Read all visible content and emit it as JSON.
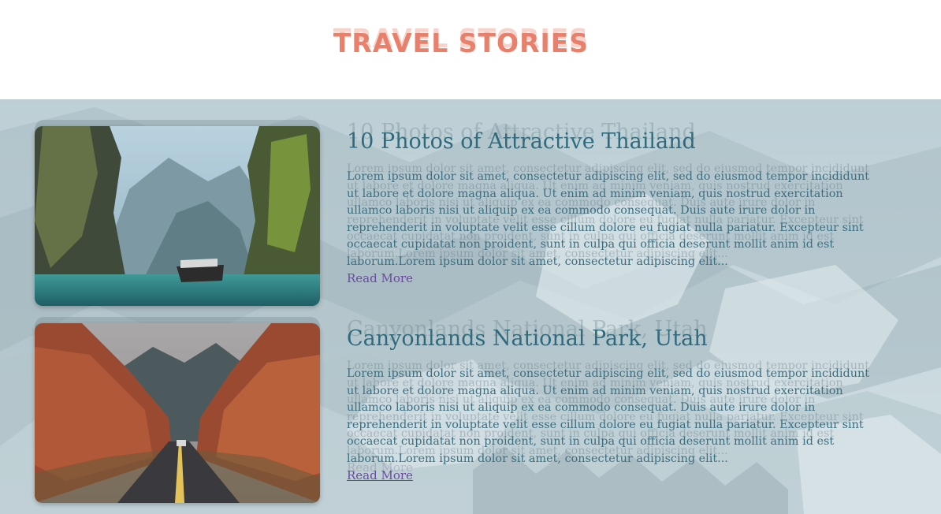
{
  "header": {
    "title": "TRAVEL STORIES",
    "title_color": "#e8806c"
  },
  "stories": [
    {
      "heading": "10 Photos of Attractive Thailand",
      "body": "Lorem ipsum dolor sit amet, consectetur adipiscing elit, sed do eiusmod tempor incididunt ut labore et dolore magna aliqua. Ut enim ad minim veniam, quis nostrud exercitation ullamco laboris nisi ut aliquip ex ea commodo consequat. Duis aute irure dolor in reprehenderit in voluptate velit esse cillum dolore eu fugiat nulla pariatur. Excepteur sint occaecat cupidatat non proident, sunt in culpa qui officia deserunt mollit anim id est laborum.Lorem ipsum dolor sit amet, consectetur adipiscing elit...",
      "link_label": "Read More",
      "image": "thailand-lagoon-boat-photo"
    },
    {
      "heading": "Canyonlands National Park, Utah",
      "body": "Lorem ipsum dolor sit amet, consectetur adipiscing elit, sed do eiusmod tempor incididunt ut labore et dolore magna aliqua. Ut enim ad minim veniam, quis nostrud exercitation ullamco laboris nisi ut aliquip ex ea commodo consequat. Duis aute irure dolor in reprehenderit in voluptate velit esse cillum dolore eu fugiat nulla pariatur. Excepteur sint occaecat cupidatat non proident, sunt in culpa qui officia deserunt mollit anim id est laborum.Lorem ipsum dolor sit amet, consectetur adipiscing elit...",
      "link_label": "Read More",
      "image": "canyon-road-photo"
    }
  ],
  "colors": {
    "heading": "#2e6a7e",
    "body_text": "#3b6e80",
    "link": "#6a4aa0",
    "background": "#c7d6db"
  }
}
